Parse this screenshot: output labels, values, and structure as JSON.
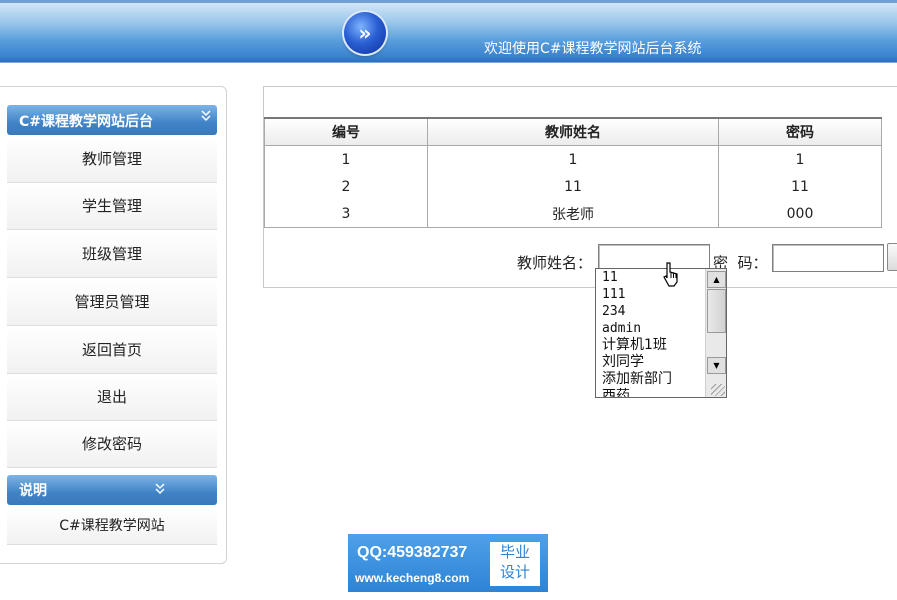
{
  "header": {
    "welcome_text": "欢迎使用C#课程教学网站后台系统",
    "logo_glyph": "»"
  },
  "sidebar": {
    "main_section_title": "C#课程教学网站后台",
    "items": [
      {
        "label": "教师管理"
      },
      {
        "label": "学生管理"
      },
      {
        "label": "班级管理"
      },
      {
        "label": "管理员管理"
      },
      {
        "label": "返回首页"
      },
      {
        "label": "退出"
      },
      {
        "label": "修改密码"
      }
    ],
    "info_section_title": "说明",
    "info_items": [
      {
        "label": "C#课程教学网站"
      }
    ],
    "chevron_glyph": "»"
  },
  "table": {
    "headers": [
      "编号",
      "教师姓名",
      "密码"
    ],
    "rows": [
      [
        "1",
        "1",
        "1"
      ],
      [
        "2",
        "11",
        "11"
      ],
      [
        "3",
        "张老师",
        "000"
      ]
    ]
  },
  "form": {
    "teacher_name_label": "教师姓名：",
    "teacher_name_value": "",
    "password_label": "密  码：",
    "password_value": ""
  },
  "autocomplete": {
    "options": [
      "11",
      "111",
      "234",
      "admin",
      "计算机1班",
      "刘同学",
      "添加新部门",
      "西药"
    ]
  },
  "watermark": {
    "qq": "QQ:459382737",
    "url": "www.kecheng8.com",
    "badge_line1": "毕业",
    "badge_line2": "设计"
  },
  "colors": {
    "header_blue": "#3b83cf",
    "menu_header_blue": "#3f83c7",
    "watermark_blue": "#2d84d6"
  }
}
